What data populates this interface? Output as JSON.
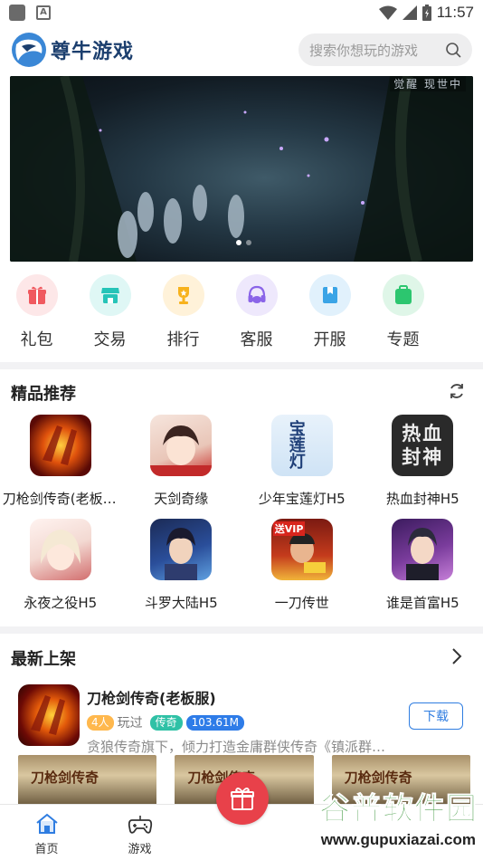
{
  "status_bar": {
    "time": "11:57"
  },
  "header": {
    "app_name": "尊牛游戏",
    "search_placeholder": "搜索你想玩的游戏"
  },
  "banner": {
    "overlay_text": "觉醒 现世中",
    "slide_count": 2,
    "active_slide": 1
  },
  "quick_nav": [
    {
      "label": "礼包",
      "icon": "gift-icon",
      "color": "#f0595f",
      "bg": "#fde7e8"
    },
    {
      "label": "交易",
      "icon": "store-icon",
      "color": "#26c4b8",
      "bg": "#dff7f5"
    },
    {
      "label": "排行",
      "icon": "trophy-icon",
      "color": "#f7b21c",
      "bg": "#fff2d9"
    },
    {
      "label": "客服",
      "icon": "headset-icon",
      "color": "#8a64e8",
      "bg": "#eee8fc"
    },
    {
      "label": "开服",
      "icon": "bookmark-flag-icon",
      "color": "#3aa4e6",
      "bg": "#e1f1fc"
    },
    {
      "label": "专题",
      "icon": "bag-icon",
      "color": "#2cc66f",
      "bg": "#dff6e8"
    }
  ],
  "featured": {
    "title": "精品推荐",
    "games": [
      {
        "name": "刀枪剑传奇(老板服)"
      },
      {
        "name": "天剑奇缘"
      },
      {
        "name": "少年宝莲灯H5"
      },
      {
        "name": "热血封神H5"
      },
      {
        "name": "永夜之役H5"
      },
      {
        "name": "斗罗大陆H5"
      },
      {
        "name": "一刀传世"
      },
      {
        "name": "谁是首富H5"
      }
    ],
    "icon_texts": {
      "g2": "宝莲灯",
      "g3": "热血封神",
      "g6": "送VIP"
    }
  },
  "newest": {
    "title": "最新上架",
    "item": {
      "name": "刀枪剑传奇(老板服)",
      "players": "4人",
      "played_suffix": "玩过",
      "genre": "传奇",
      "size": "103.61M",
      "description": "贪狼传奇旗下，倾力打造金庸群侠传奇《镇派群…",
      "download_label": "下载"
    },
    "screenshot_text": "刀枪剑传奇"
  },
  "tabbar": [
    {
      "label": "首页",
      "icon": "home-icon",
      "active": true
    },
    {
      "label": "游戏",
      "icon": "gamepad-icon",
      "active": false
    }
  ],
  "watermark": {
    "brand": "谷普软件园",
    "url": "www.gupuxiazai.com"
  },
  "colors": {
    "accent_blue": "#2f7de1",
    "gift_red": "#e8414a",
    "genre_green": "#2fc1a6",
    "size_blue": "#2e7ce8"
  }
}
